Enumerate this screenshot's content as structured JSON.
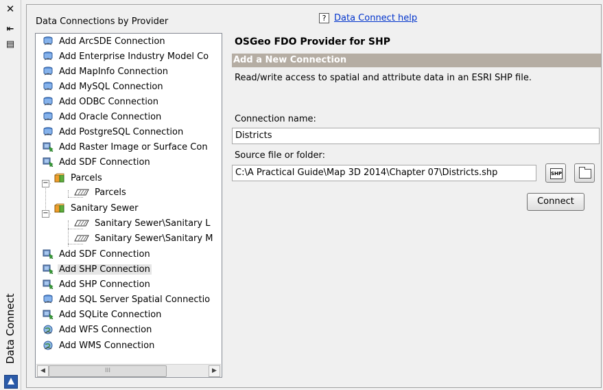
{
  "side_strip": {
    "title": "Data Connect",
    "close_glyph": "✕",
    "pin_glyph": "⇤",
    "menu_glyph": "▤"
  },
  "left_panel": {
    "title": "Data Connections by Provider"
  },
  "tree": {
    "items": [
      {
        "label": "Add ArcSDE Connection",
        "icon": "database-icon"
      },
      {
        "label": "Add Enterprise Industry Model Co",
        "icon": "database-icon"
      },
      {
        "label": "Add MapInfo Connection",
        "icon": "database-icon"
      },
      {
        "label": "Add MySQL Connection",
        "icon": "database-icon"
      },
      {
        "label": "Add ODBC Connection",
        "icon": "database-icon"
      },
      {
        "label": "Add Oracle Connection",
        "icon": "database-icon"
      },
      {
        "label": "Add PostgreSQL Connection",
        "icon": "database-icon"
      },
      {
        "label": "Add Raster Image or Surface Con",
        "icon": "raster-icon"
      },
      {
        "label": "Add SDF Connection",
        "icon": "raster-icon"
      },
      {
        "label": "Parcels",
        "icon": "feature-source-icon"
      },
      {
        "label": "Parcels",
        "icon": "feature-class-icon"
      },
      {
        "label": "Sanitary Sewer",
        "icon": "feature-source-icon"
      },
      {
        "label": "Sanitary Sewer\\Sanitary L",
        "icon": "feature-class-icon"
      },
      {
        "label": "Sanitary Sewer\\Sanitary M",
        "icon": "feature-class-icon"
      },
      {
        "label": "Add SDF Connection",
        "icon": "raster-icon"
      },
      {
        "label": "Add SHP Connection",
        "icon": "raster-icon",
        "selected": true
      },
      {
        "label": "Add SHP Connection",
        "icon": "raster-icon"
      },
      {
        "label": "Add SQL Server Spatial Connectio",
        "icon": "database-icon"
      },
      {
        "label": "Add SQLite Connection",
        "icon": "raster-icon"
      },
      {
        "label": "Add WFS Connection",
        "icon": "globe-icon"
      },
      {
        "label": "Add WMS Connection",
        "icon": "globe-icon"
      }
    ],
    "scroll_left": "◀",
    "scroll_right": "▶",
    "thumb_grip": "III"
  },
  "help": {
    "icon_glyph": "?",
    "link_text": "Data Connect help"
  },
  "details": {
    "provider_title": "OSGeo FDO Provider for SHP",
    "section_header": "Add a New Connection",
    "description": "Read/write access to spatial and attribute data in an ESRI SHP file.",
    "connection_name_label": "Connection name:",
    "connection_name_value": "Districts",
    "source_label": "Source file or folder:",
    "source_value": "C:\\A Practical Guide\\Map 3D 2014\\Chapter 07\\Districts.shp",
    "shp_button_text": "SHP",
    "connect_button": "Connect"
  },
  "colors": {
    "section_bg": "#b5ada3",
    "link": "#0033cc",
    "selected_row": "#e5e5e5"
  }
}
